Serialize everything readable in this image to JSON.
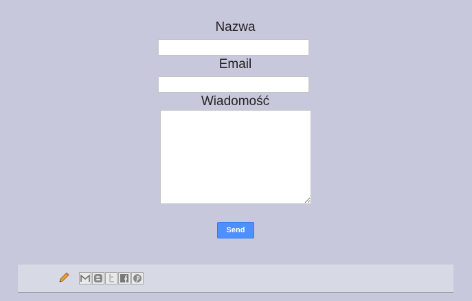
{
  "form": {
    "name_label": "Nazwa",
    "name_value": "",
    "email_label": "Email",
    "email_value": "",
    "message_label": "Wiadomość",
    "message_value": "",
    "send_label": "Send"
  },
  "footer": {
    "edit_icon": "pencil-icon",
    "share_icons": [
      "email-icon",
      "blogger-icon",
      "twitter-icon",
      "facebook-icon",
      "pinterest-icon"
    ]
  },
  "colors": {
    "background": "#c8c8dc",
    "footer_background": "#d7d9e5",
    "send_button": "#4d90fe"
  }
}
